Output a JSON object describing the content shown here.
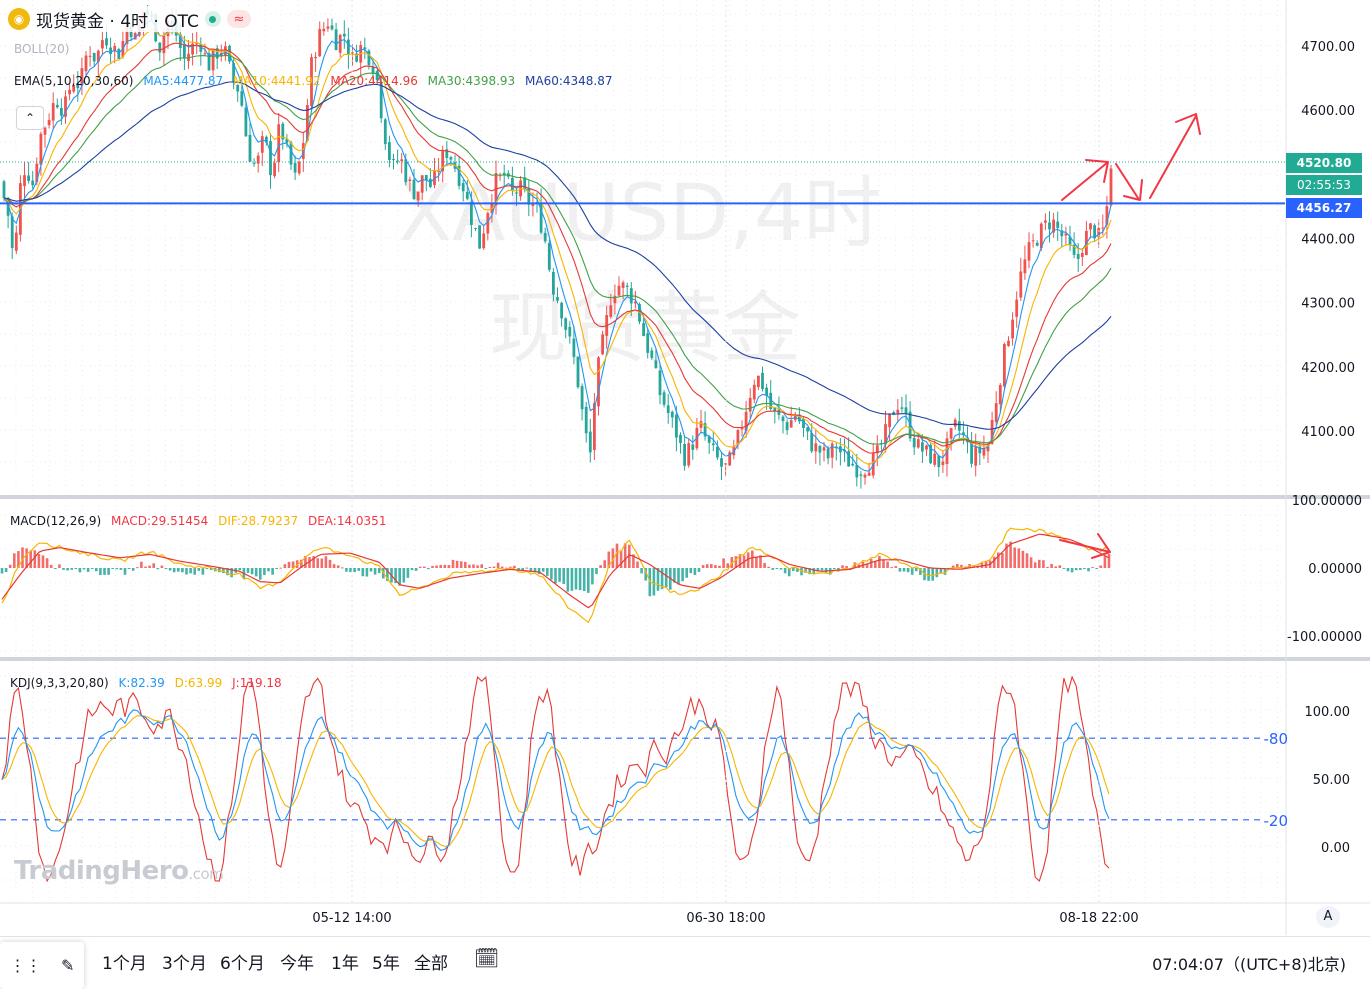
{
  "header": {
    "symbol_title": "现货黄金 · 4时 · OTC",
    "wave_icon_glyph": "≈"
  },
  "indicators": {
    "boll": "BOLL(20)",
    "ema_title": "EMA(5,10,20,30,60)",
    "ma5": "MA5:4477.87",
    "ma10": "MA10:4441.92",
    "ma20": "MA20:4414.96",
    "ma30": "MA30:4398.93",
    "ma60": "MA60:4348.87",
    "macd_title": "MACD(12,26,9)",
    "macd_value": "MACD:29.51454",
    "dif_value": "DIF:28.79237",
    "dea_value": "DEA:14.0351",
    "kdj_title": "KDJ(9,3,3,20,80)",
    "k_value": "K:82.39",
    "d_value": "D:63.99",
    "j_value": "J:119.18"
  },
  "watermark": {
    "line1": "XAUUSD,4时",
    "line2": "现货黄金",
    "logo_main": "TradingHero",
    "logo_suffix": ".com"
  },
  "price_labels": {
    "current": "4520.80",
    "countdown": "02:55:53",
    "horizontal_line": "4456.27"
  },
  "bottom_bar": {
    "ranges": [
      "1个月",
      "3个月",
      "6个月",
      "今年",
      "1年",
      "5年",
      "全部"
    ],
    "clock": "07:04:07（(UTC+8)北京)",
    "auto_label": "A"
  },
  "colors": {
    "up": "#ef5350",
    "down": "#26a69a",
    "ma5": "#2196f3",
    "ma10": "#f7b500",
    "ma20": "#e53935",
    "ma30": "#43a047",
    "ma60": "#1e3fa0",
    "hline": "#2962ff",
    "annotation": "#f23645"
  },
  "chart_data": [
    {
      "type": "candlestick",
      "title": "现货黄金 · 4时 · OTC",
      "y_axis_ticks": [
        "4700.00",
        "4600.00",
        "4500.00",
        "4400.00",
        "4300.00",
        "4200.00",
        "4100.00"
      ],
      "ylim": [
        4050,
        4770
      ],
      "x_axis_ticks": [
        "05-12 14:00",
        "06-30 18:00",
        "08-18 22:00"
      ],
      "horizontal_line": 4456.27,
      "last_price": 4520.8,
      "close_path": [
        [
          0,
          4490
        ],
        [
          8,
          4440
        ],
        [
          14,
          4360
        ],
        [
          20,
          4480
        ],
        [
          26,
          4520
        ],
        [
          32,
          4480
        ],
        [
          40,
          4560
        ],
        [
          48,
          4590
        ],
        [
          56,
          4620
        ],
        [
          64,
          4600
        ],
        [
          72,
          4650
        ],
        [
          80,
          4640
        ],
        [
          88,
          4700
        ],
        [
          96,
          4680
        ],
        [
          104,
          4720
        ],
        [
          112,
          4700
        ],
        [
          120,
          4690
        ],
        [
          128,
          4740
        ],
        [
          136,
          4710
        ],
        [
          144,
          4760
        ],
        [
          152,
          4740
        ],
        [
          160,
          4700
        ],
        [
          168,
          4740
        ],
        [
          176,
          4720
        ],
        [
          184,
          4680
        ],
        [
          192,
          4700
        ],
        [
          200,
          4710
        ],
        [
          208,
          4670
        ],
        [
          216,
          4690
        ],
        [
          224,
          4700
        ],
        [
          232,
          4650
        ],
        [
          240,
          4630
        ],
        [
          248,
          4540
        ],
        [
          256,
          4510
        ],
        [
          264,
          4560
        ],
        [
          272,
          4500
        ],
        [
          280,
          4580
        ],
        [
          288,
          4530
        ],
        [
          296,
          4490
        ],
        [
          304,
          4560
        ],
        [
          312,
          4680
        ],
        [
          320,
          4720
        ],
        [
          328,
          4740
        ],
        [
          336,
          4710
        ],
        [
          344,
          4720
        ],
        [
          352,
          4680
        ],
        [
          360,
          4700
        ],
        [
          368,
          4690
        ],
        [
          376,
          4660
        ],
        [
          384,
          4570
        ],
        [
          392,
          4510
        ],
        [
          400,
          4530
        ],
        [
          408,
          4490
        ],
        [
          416,
          4470
        ],
        [
          424,
          4500
        ],
        [
          432,
          4480
        ],
        [
          440,
          4520
        ],
        [
          448,
          4540
        ],
        [
          456,
          4510
        ],
        [
          464,
          4480
        ],
        [
          472,
          4430
        ],
        [
          480,
          4390
        ],
        [
          488,
          4450
        ],
        [
          496,
          4490
        ],
        [
          504,
          4500
        ],
        [
          512,
          4470
        ],
        [
          520,
          4480
        ],
        [
          528,
          4460
        ],
        [
          536,
          4450
        ],
        [
          544,
          4410
        ],
        [
          552,
          4330
        ],
        [
          560,
          4300
        ],
        [
          568,
          4250
        ],
        [
          576,
          4200
        ],
        [
          584,
          4110
        ],
        [
          590,
          4060
        ],
        [
          596,
          4180
        ],
        [
          604,
          4250
        ],
        [
          612,
          4320
        ],
        [
          620,
          4330
        ],
        [
          628,
          4320
        ],
        [
          636,
          4300
        ],
        [
          644,
          4250
        ],
        [
          652,
          4210
        ],
        [
          660,
          4160
        ],
        [
          668,
          4130
        ],
        [
          676,
          4100
        ],
        [
          684,
          4060
        ],
        [
          692,
          4080
        ],
        [
          700,
          4110
        ],
        [
          708,
          4080
        ],
        [
          716,
          4060
        ],
        [
          724,
          4040
        ],
        [
          732,
          4060
        ],
        [
          740,
          4100
        ],
        [
          748,
          4150
        ],
        [
          756,
          4190
        ],
        [
          764,
          4170
        ],
        [
          772,
          4130
        ],
        [
          780,
          4120
        ],
        [
          788,
          4110
        ],
        [
          796,
          4130
        ],
        [
          804,
          4100
        ],
        [
          812,
          4080
        ],
        [
          820,
          4070
        ],
        [
          828,
          4060
        ],
        [
          836,
          4080
        ],
        [
          844,
          4060
        ],
        [
          852,
          4050
        ],
        [
          860,
          4040
        ],
        [
          868,
          4050
        ],
        [
          876,
          4060
        ],
        [
          884,
          4090
        ],
        [
          892,
          4130
        ],
        [
          900,
          4150
        ],
        [
          908,
          4110
        ],
        [
          916,
          4080
        ],
        [
          924,
          4070
        ],
        [
          932,
          4060
        ],
        [
          940,
          4050
        ],
        [
          948,
          4080
        ],
        [
          956,
          4110
        ],
        [
          964,
          4090
        ],
        [
          972,
          4060
        ],
        [
          980,
          4070
        ],
        [
          988,
          4080
        ],
        [
          996,
          4150
        ],
        [
          1004,
          4220
        ],
        [
          1012,
          4280
        ],
        [
          1020,
          4340
        ],
        [
          1028,
          4380
        ],
        [
          1036,
          4400
        ],
        [
          1044,
          4420
        ],
        [
          1052,
          4430
        ],
        [
          1060,
          4410
        ],
        [
          1068,
          4390
        ],
        [
          1076,
          4360
        ],
        [
          1084,
          4400
        ],
        [
          1092,
          4420
        ],
        [
          1100,
          4400
        ],
        [
          1106,
          4430
        ],
        [
          1110,
          4520
        ]
      ]
    },
    {
      "type": "histogram+line",
      "title": "MACD(12,26,9)",
      "y_axis_ticks": [
        "100.00000",
        "0.00000",
        "-100.00000"
      ],
      "ylim": [
        -120,
        110
      ],
      "dif_path": [
        [
          0,
          -60
        ],
        [
          20,
          10
        ],
        [
          40,
          40
        ],
        [
          60,
          30
        ],
        [
          90,
          20
        ],
        [
          120,
          10
        ],
        [
          150,
          25
        ],
        [
          180,
          5
        ],
        [
          210,
          0
        ],
        [
          240,
          -10
        ],
        [
          260,
          -30
        ],
        [
          280,
          -20
        ],
        [
          300,
          10
        ],
        [
          320,
          30
        ],
        [
          350,
          20
        ],
        [
          380,
          0
        ],
        [
          400,
          -40
        ],
        [
          420,
          -30
        ],
        [
          450,
          -10
        ],
        [
          480,
          -5
        ],
        [
          510,
          0
        ],
        [
          540,
          -10
        ],
        [
          570,
          -60
        ],
        [
          590,
          -80
        ],
        [
          610,
          10
        ],
        [
          630,
          40
        ],
        [
          650,
          -20
        ],
        [
          680,
          -40
        ],
        [
          700,
          -30
        ],
        [
          720,
          -10
        ],
        [
          750,
          30
        ],
        [
          770,
          20
        ],
        [
          790,
          0
        ],
        [
          820,
          -10
        ],
        [
          850,
          0
        ],
        [
          880,
          20
        ],
        [
          900,
          10
        ],
        [
          930,
          -10
        ],
        [
          960,
          0
        ],
        [
          990,
          10
        ],
        [
          1010,
          60
        ],
        [
          1040,
          55
        ],
        [
          1070,
          40
        ],
        [
          1090,
          25
        ],
        [
          1110,
          29
        ]
      ],
      "dea_path": [
        [
          0,
          -50
        ],
        [
          20,
          -10
        ],
        [
          40,
          25
        ],
        [
          60,
          30
        ],
        [
          90,
          22
        ],
        [
          120,
          15
        ],
        [
          150,
          20
        ],
        [
          180,
          10
        ],
        [
          210,
          3
        ],
        [
          240,
          -5
        ],
        [
          260,
          -20
        ],
        [
          280,
          -22
        ],
        [
          300,
          0
        ],
        [
          320,
          20
        ],
        [
          350,
          22
        ],
        [
          380,
          8
        ],
        [
          400,
          -25
        ],
        [
          420,
          -30
        ],
        [
          450,
          -15
        ],
        [
          480,
          -8
        ],
        [
          510,
          -2
        ],
        [
          540,
          -6
        ],
        [
          570,
          -40
        ],
        [
          590,
          -60
        ],
        [
          610,
          -10
        ],
        [
          630,
          20
        ],
        [
          650,
          5
        ],
        [
          680,
          -25
        ],
        [
          700,
          -30
        ],
        [
          720,
          -15
        ],
        [
          750,
          15
        ],
        [
          770,
          18
        ],
        [
          790,
          5
        ],
        [
          820,
          -5
        ],
        [
          850,
          -2
        ],
        [
          880,
          12
        ],
        [
          900,
          12
        ],
        [
          930,
          0
        ],
        [
          960,
          -2
        ],
        [
          990,
          5
        ],
        [
          1010,
          35
        ],
        [
          1040,
          50
        ],
        [
          1070,
          42
        ],
        [
          1090,
          30
        ],
        [
          1110,
          14
        ]
      ]
    },
    {
      "type": "line",
      "title": "KDJ(9,3,3,20,80)",
      "y_axis_ticks": [
        "100.00",
        "50.00",
        "0.00"
      ],
      "levels": [
        80,
        20
      ],
      "level_labels": [
        "80",
        "20"
      ],
      "ylim": [
        -30,
        130
      ]
    }
  ]
}
